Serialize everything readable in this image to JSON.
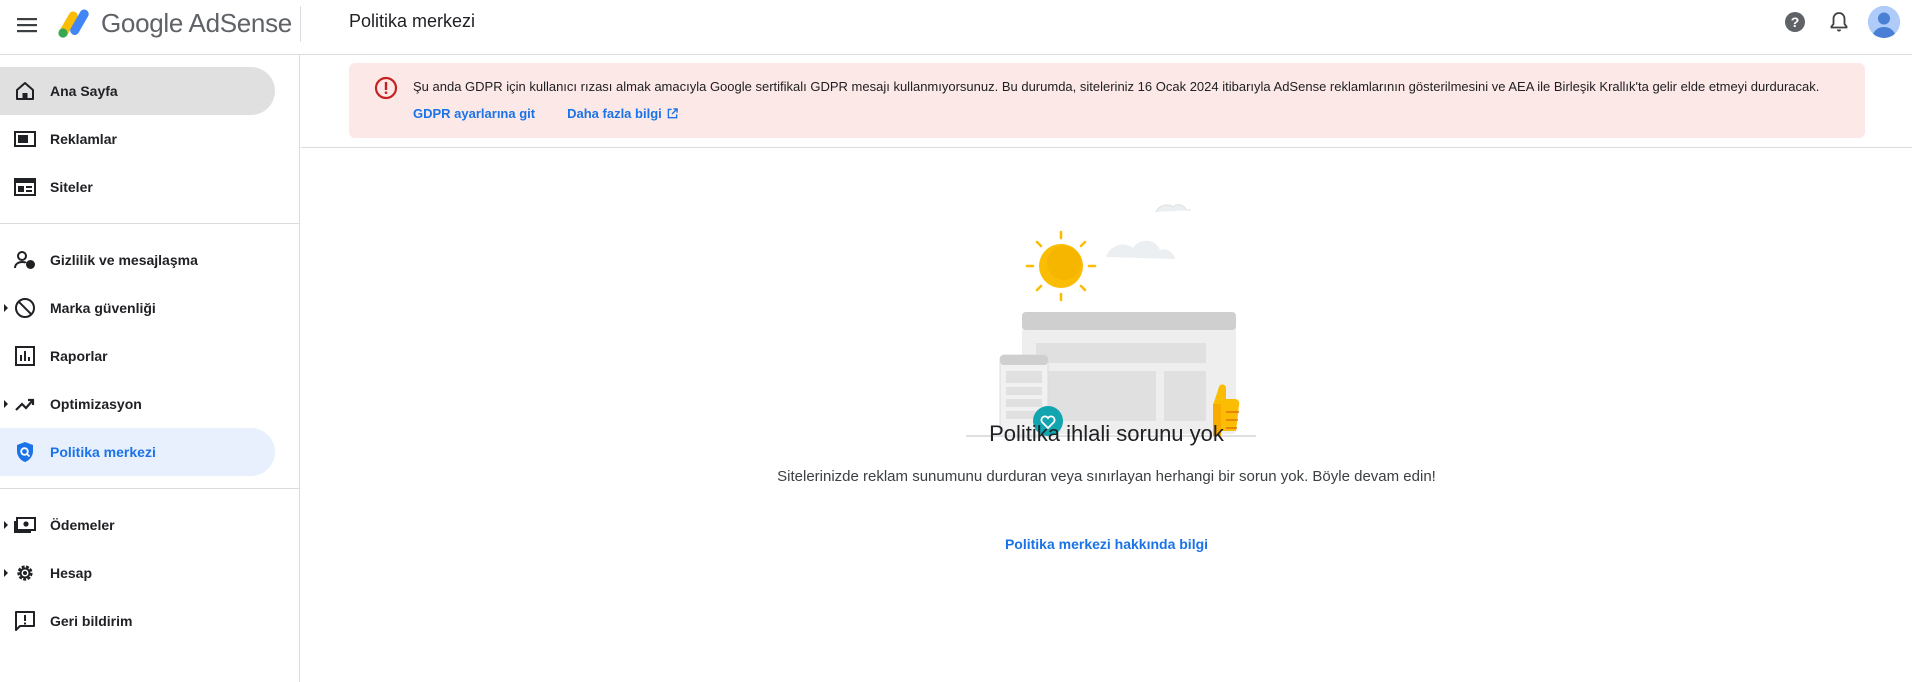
{
  "app": {
    "logo_text": "Google AdSense",
    "page_title": "Politika merkezi"
  },
  "topbar": {
    "icons": [
      "menu-icon",
      "help-icon",
      "bell-icon",
      "avatar"
    ]
  },
  "sidebar": {
    "items": [
      {
        "label": "Ana Sayfa",
        "icon": "home-icon"
      },
      {
        "label": "Reklamlar",
        "icon": "ads-icon"
      },
      {
        "label": "Siteler",
        "icon": "sites-icon"
      },
      {
        "label": "Gizlilik ve mesajlaşma",
        "icon": "privacy-icon"
      },
      {
        "label": "Marka güvenliği",
        "icon": "block-icon"
      },
      {
        "label": "Raporlar",
        "icon": "reports-icon"
      },
      {
        "label": "Optimizasyon",
        "icon": "trending-icon"
      },
      {
        "label": "Politika merkezi",
        "icon": "policy-shield-icon"
      },
      {
        "label": "Ödemeler",
        "icon": "payments-icon"
      },
      {
        "label": "Hesap",
        "icon": "gear-icon"
      },
      {
        "label": "Geri bildirim",
        "icon": "feedback-icon"
      }
    ]
  },
  "alert": {
    "message": "Şu anda GDPR için kullanıcı rızası almak amacıyla Google sertifikalı GDPR mesajı kullanmıyorsunuz. Bu durumda, siteleriniz 16 Ocak 2024 itibarıyla AdSense reklamlarının gösterilmesini ve AEA ile Birleşik Krallık'ta gelir elde etmeyi durduracak.",
    "link_gdpr": "GDPR ayarlarına git",
    "link_more": "Daha fazla bilgi"
  },
  "empty_state": {
    "title": "Politika ihlali sorunu yok",
    "description": "Sitelerinizde reklam sunumunu durduran veya sınırlayan herhangi bir sorun yok. Böyle devam edin!",
    "learn_link": "Politika merkezi hakkında bilgi"
  },
  "colors": {
    "accent": "#1a73e8",
    "alert_bg": "#fce8e6",
    "alert_icon": "#c5221f",
    "active_nav_bg": "#e8f0fe",
    "home_nav_bg": "#e0e0e0"
  }
}
